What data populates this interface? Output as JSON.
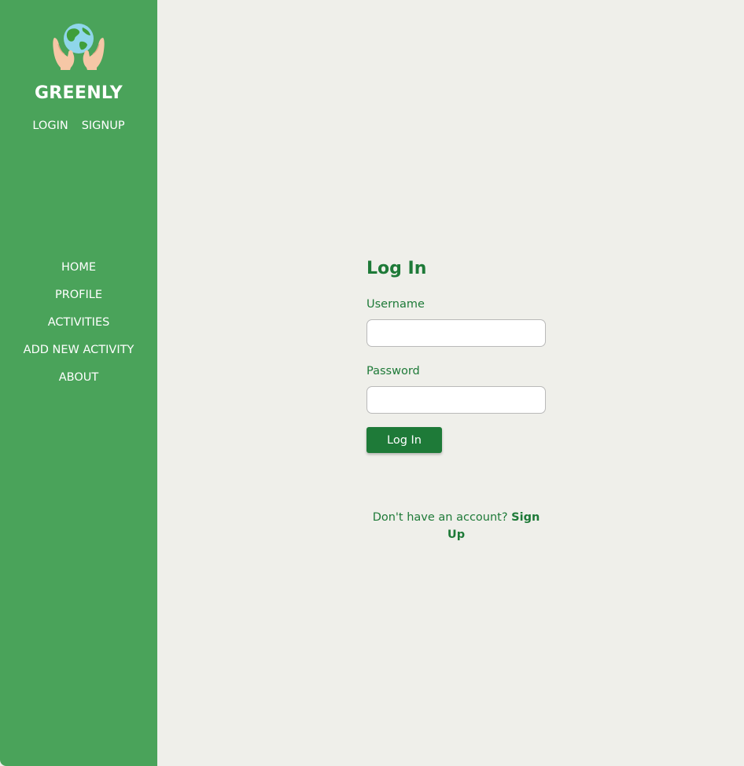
{
  "sidebar": {
    "brand": "GREENLY",
    "auth_links": {
      "login": "LOGIN",
      "signup": "SIGNUP"
    },
    "nav": [
      {
        "label": "HOME"
      },
      {
        "label": "PROFILE"
      },
      {
        "label": "ACTIVITIES"
      },
      {
        "label": "ADD NEW ACTIVITY"
      },
      {
        "label": "ABOUT"
      }
    ]
  },
  "login": {
    "title": "Log In",
    "username_label": "Username",
    "username_value": "",
    "password_label": "Password",
    "password_value": "",
    "submit_label": "Log In"
  },
  "signup_prompt": {
    "text": "Don't have an account? ",
    "link": "Sign Up"
  },
  "colors": {
    "sidebar": "#4aa35a",
    "accent": "#1e7a38",
    "background": "#efefea"
  },
  "icons": {
    "logo": "hands-holding-globe-icon"
  }
}
